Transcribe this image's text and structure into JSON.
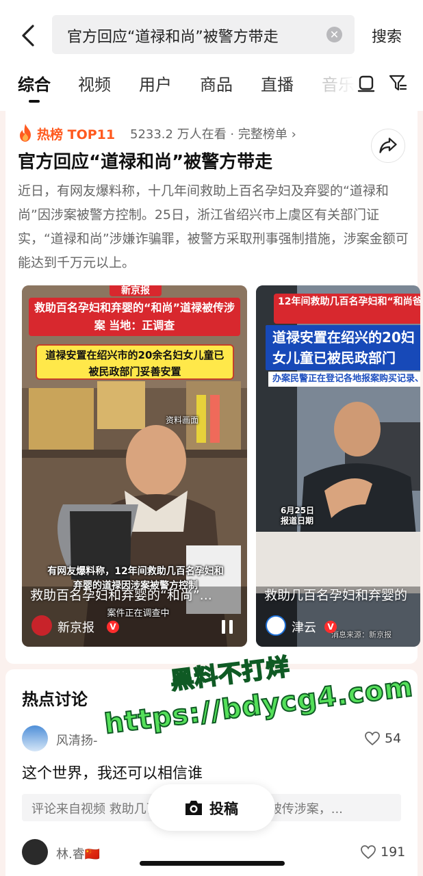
{
  "search": {
    "query": "官方回应“道禄和尚”被警方带走",
    "button_label": "搜索"
  },
  "tabs": [
    {
      "label": "综合"
    },
    {
      "label": "视频"
    },
    {
      "label": "用户"
    },
    {
      "label": "商品"
    },
    {
      "label": "直播"
    },
    {
      "label": "音乐"
    }
  ],
  "hot": {
    "label": "热榜 TOP11",
    "viewers": "5233.2 万人在看 · 完整榜单 ›",
    "headline": "官方回应“道禄和尚”被警方带走",
    "summary": "近日，有网友爆料称，十几年间救助上百名孕妇及弃婴的“道禄和尚”因涉案被警方控制。25日，浙江省绍兴市上虞区有关部门证实，“道禄和尚”涉嫌诈骗罪，被警方采取刑事强制措施，涉案金额可能达到千万元以上。"
  },
  "videos": [
    {
      "brand_tag": "新京报",
      "red_banner": "救助百名孕妇和弃婴的“和尚”道禄被传涉案 当地：正调查",
      "yellow_banner": "道禄安置在绍兴市的20余名妇女儿童已被民政部门妥善安置",
      "scene_label": "资料画面",
      "caption": "有网友爆料称，12年间救助几百名孕妇和弃婴的道禄因涉案被警方控制",
      "caption2": "案件正在调查中",
      "title": "救助百名孕妇和弃婴的“和尚”...",
      "source": "新京报"
    },
    {
      "red_banner": "12年间救助几百名孕妇和“和尚爸爸”道禄因涉案被警",
      "blue_banner": "道禄安置在绍兴的20妇女儿童已被民政部门",
      "sub_banner": "办案民警正在登记各地报案购买记录、转账记录等证据",
      "date_label": "6月25日 报道日期",
      "info_source": "消息来源：新京报",
      "title": "救助几百名孕妇和弃婴的",
      "source": "津云"
    }
  ],
  "discussion": {
    "title": "热点讨论",
    "comments": [
      {
        "user": "风清扬-",
        "likes": "54",
        "text": "这个世界，我还可以相信谁",
        "reference": "评论来自视频 救助几百名孕妇和弃婴的道禄被传涉案，..."
      },
      {
        "user": "林.睿🇨🇳",
        "likes": "191"
      }
    ]
  },
  "post_button": {
    "label": "投稿"
  },
  "watermark": {
    "line1": "黑料不打烊",
    "line2": "https://bdycg4.com"
  },
  "colors": {
    "accent_hot": "#ff5a1f",
    "verified_badge": "#ff2d2d",
    "watermark": "#55e05a"
  }
}
